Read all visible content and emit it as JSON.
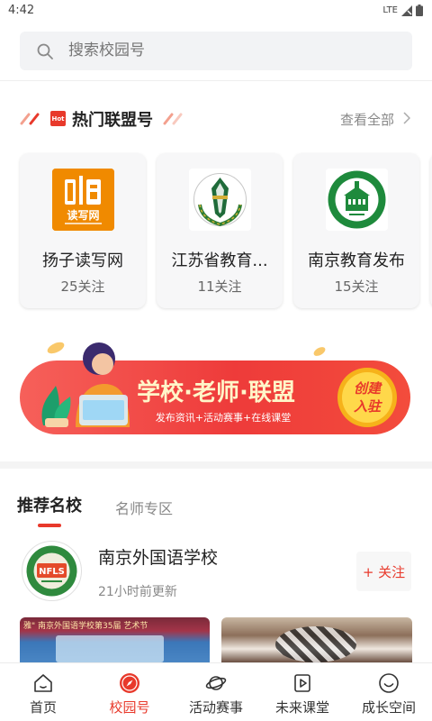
{
  "status": {
    "time": "4:42",
    "network": "LTE"
  },
  "search": {
    "placeholder": "搜索校园号"
  },
  "alliance": {
    "badge": "Hot",
    "title": "热门联盟号",
    "view_all": "查看全部",
    "cards": [
      {
        "name": "扬子读写网",
        "follows": "25关注",
        "logo_text": "读写网"
      },
      {
        "name": "江苏省教育...",
        "follows": "11关注"
      },
      {
        "name": "南京教育发布",
        "follows": "15关注"
      }
    ]
  },
  "banner": {
    "headline": "学校·老师·联盟",
    "sub": "发布资讯+活动赛事+在线课堂",
    "cta_line1": "创建",
    "cta_line2": "入驻"
  },
  "tabs": {
    "active": "推荐名校",
    "inactive": "名师专区"
  },
  "school": {
    "name": "南京外国语学校",
    "time": "21小时前更新",
    "follow": "+ 关注",
    "logo_text": "NFLS"
  },
  "photos": {
    "caption": "雅\" 南京外国语学校第35届 艺术节"
  },
  "nav": {
    "items": [
      {
        "label": "首页",
        "icon": "home-icon"
      },
      {
        "label": "校园号",
        "icon": "compass-icon"
      },
      {
        "label": "活动赛事",
        "icon": "planet-icon"
      },
      {
        "label": "未来课堂",
        "icon": "video-icon"
      },
      {
        "label": "成长空间",
        "icon": "smile-icon"
      }
    ],
    "active_index": 1
  },
  "colors": {
    "accent": "#e8392b",
    "brand_orange": "#f08a00",
    "green": "#1e8a3c"
  }
}
